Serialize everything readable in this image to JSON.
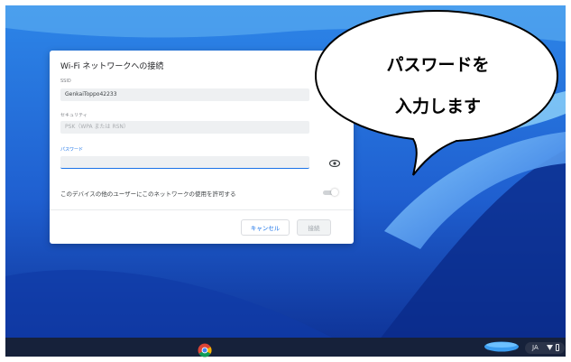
{
  "dialog": {
    "title": "Wi-Fi ネットワークへの接続",
    "ssid_label": "SSID",
    "ssid_value": "GenkaiToppo42233",
    "security_label": "セキュリティ",
    "security_value": "PSK（WPA または RSN）",
    "password_label": "パスワード",
    "password_value": "",
    "share_label": "このデバイスの他のユーザーにこのネットワークの使用を許可する",
    "share_enabled": false,
    "cancel_label": "キャンセル",
    "connect_label": "接続"
  },
  "callout": {
    "line1": "パスワードを",
    "line2": "入力します"
  },
  "shelf": {
    "language": "JA",
    "icons": [
      "chrome-icon",
      "cloud-icon",
      "wifi-icon",
      "battery-icon"
    ]
  },
  "colors": {
    "wallpaper": "#1f55c4",
    "accent": "#1a73e8",
    "shelf": "#16213a"
  }
}
